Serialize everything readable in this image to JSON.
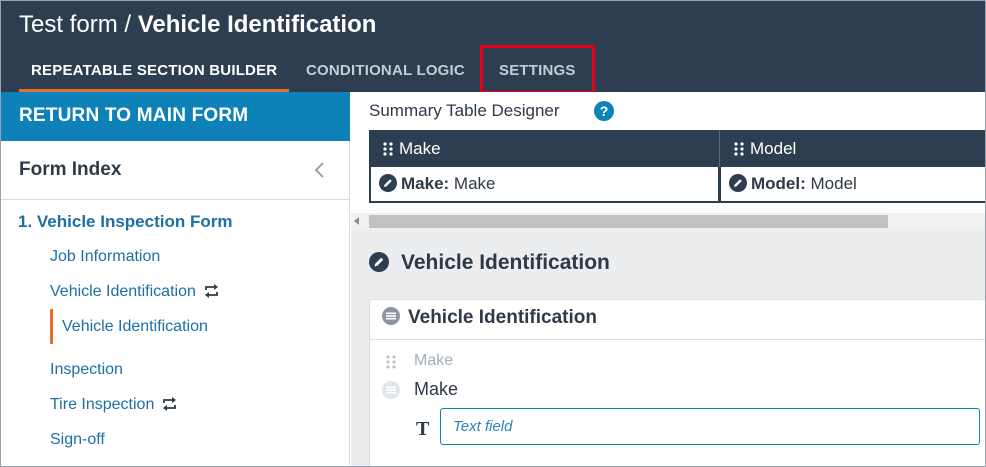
{
  "header": {
    "title_prefix": "Test form / ",
    "title_bold": "Vehicle Identification",
    "tabs": [
      {
        "label": "REPEATABLE SECTION BUILDER",
        "active": true
      },
      {
        "label": "CONDITIONAL LOGIC",
        "active": false
      },
      {
        "label": "SETTINGS",
        "active": false,
        "highlighted": true
      }
    ]
  },
  "sidebar": {
    "return_label": "RETURN TO MAIN FORM",
    "index_title": "Form Index",
    "collapse_icon": "chevron-left-icon",
    "items": [
      {
        "label": "1. Vehicle Inspection Form",
        "level": 1
      },
      {
        "label": "Job Information",
        "level": 2
      },
      {
        "label": "Vehicle Identification",
        "level": 2,
        "repeatable": true
      },
      {
        "label": "Vehicle Identification",
        "level": 3,
        "active": true
      },
      {
        "label": "Inspection",
        "level": 2
      },
      {
        "label": "Tire Inspection",
        "level": 2,
        "repeatable": true
      },
      {
        "label": "Sign-off",
        "level": 2
      }
    ]
  },
  "designer": {
    "title": "Summary Table Designer",
    "help_icon": "?",
    "columns": [
      {
        "header": "Make",
        "cell_label": "Make:",
        "cell_value": " Make"
      },
      {
        "header": "Model",
        "cell_label": "Model:",
        "cell_value": " Model"
      }
    ]
  },
  "section": {
    "title": "Vehicle Identification",
    "card_title": "Vehicle Identification",
    "faint_label": "Make",
    "field_label": "Make",
    "input_placeholder": "Text field",
    "field_type_icon": "T"
  },
  "colors": {
    "header_bg": "#2d3e50",
    "accent_blue": "#0e82b8",
    "active_tab_underline": "#e1712b",
    "highlight_box": "#e2001a",
    "link_blue": "#1d6fa5"
  }
}
